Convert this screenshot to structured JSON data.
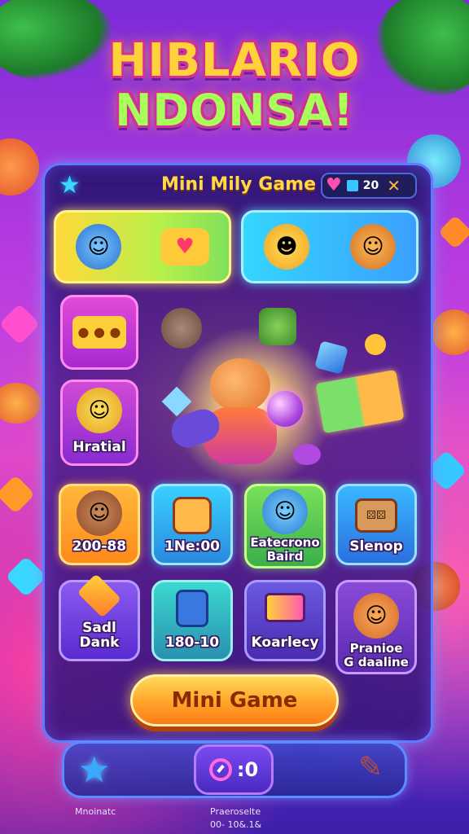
{
  "header": {
    "title_line1": "HIBLARIO",
    "title_line2": "NDONSA!"
  },
  "panel": {
    "title": "Mini Mily Game",
    "stats": {
      "value": "20"
    }
  },
  "tiles": {
    "side_top": {
      "label": ""
    },
    "side_mid": {
      "label": "Hratial"
    },
    "row1": [
      {
        "label": "200-88"
      },
      {
        "label": "1Ne:00"
      },
      {
        "label": "Eatecrono\nBaird"
      },
      {
        "label": "Slenop"
      }
    ],
    "row2": [
      {
        "label": "Sadl Dank"
      },
      {
        "label": "180-10"
      },
      {
        "label": "Koarlecy"
      },
      {
        "label": "Pranioe\nG daaline"
      }
    ]
  },
  "cta": {
    "label": "Mini Game"
  },
  "bottom_bar": {
    "count": ":0"
  },
  "footer": {
    "left": "Mnoinatc",
    "right_line1": "Praeroselte",
    "right_line2": "00- 10&.1&"
  },
  "colors": {
    "accent_gold": "#ffd23a",
    "accent_cyan": "#3ad7ff",
    "panel_border": "#5a7dff",
    "cta_orange": "#ff8a1e"
  }
}
